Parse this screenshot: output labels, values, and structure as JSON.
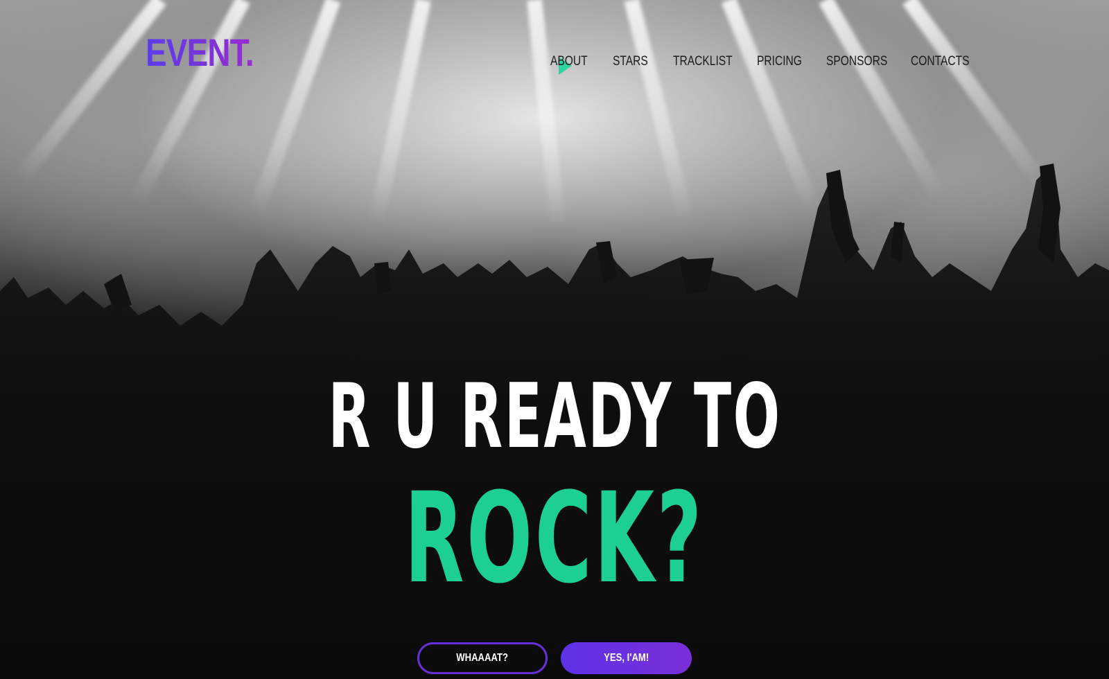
{
  "brand": {
    "logo_text": "EVENT.",
    "accent_color": "#1dcf93",
    "brand_gradient": [
      "#5b3df0",
      "#9b2ad0"
    ]
  },
  "nav": {
    "items": [
      {
        "label": "ABOUT"
      },
      {
        "label": "STARS"
      },
      {
        "label": "TRACKLIST"
      },
      {
        "label": "PRICING"
      },
      {
        "label": "SPONSORS"
      },
      {
        "label": "CONTACTS"
      }
    ]
  },
  "hero": {
    "headline_line1": "R U READY TO",
    "headline_line2": "ROCK?",
    "background_image": "concert-crowd-stage-lights"
  },
  "buttons": {
    "secondary_label": "WHAAAAT?",
    "primary_label": "YES, I'AM!"
  }
}
